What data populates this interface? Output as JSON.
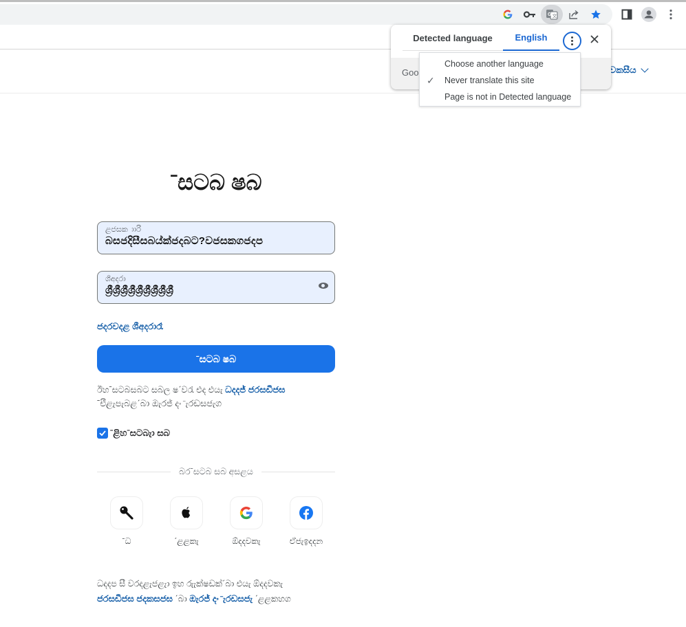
{
  "browser": {
    "omnibox_icons": [
      "google-lens-icon",
      "password-key-icon",
      "translate-icon",
      "share-icon",
      "bookmark-star-icon"
    ],
    "toolbar_icons": [
      "side-panel-icon",
      "profile-avatar-icon",
      "chrome-menu-icon"
    ],
    "accent_color": "#1a73e8"
  },
  "translate_popup": {
    "tabs": [
      {
        "label": "Detected language",
        "selected": false
      },
      {
        "label": "English",
        "selected": true
      }
    ],
    "footer_text": "Goo",
    "menu": {
      "items": [
        {
          "label": "Choose another language",
          "checked": false
        },
        {
          "label": "Never translate this site",
          "checked": true
        },
        {
          "label": "Page is not in Detected language",
          "checked": false
        }
      ]
    }
  },
  "header": {
    "language_selector": "වකසීය"
  },
  "login": {
    "title": "ˉසටබ ෂබ",
    "username": {
      "label": "ළජසක ාාරි",
      "value": "බසජදිසීසබය්ක්ජදබට?වජසකගජදප"
    },
    "password": {
      "label": "ශීඅදරා",
      "value": "ශ්‍රීශ්‍රීශ්‍රීශ්‍රීශ්‍රීශ්‍රීශ්‍රීශ්‍රීශ්‍රී",
      "toggle_icon": "eye-icon"
    },
    "forgot_password": "ජදරවදළ ශීඅදරාරෑ",
    "submit_label": "ˉසටබ ෂබ",
    "terms": {
      "prefix": "ඊහˉසටබසබට සබල ෂˊවරැ එද එයැ ",
      "link1": "ධදදජ් ජරසඩීජඝ",
      "line2_link": "ˉඑිළැපැබළˊබා ඔැරජ් දං ̄ැරඩසජැග"
    },
    "keep_signed_in": {
      "label": "ˉළිහˉසටබැා සබ",
      "checked": true
    },
    "divider_text": "බරˉසටබ සබ අසළය",
    "social": [
      {
        "icon": "passkey-icon",
        "label": "ˉධ"
      },
      {
        "icon": "apple-icon",
        "label": "ˊළළකැ"
      },
      {
        "icon": "google-icon",
        "label": "ඕදදවකැ"
      },
      {
        "icon": "facebook-icon",
        "label": "ඒජැඉදදන"
      }
    ],
    "footer_note": {
      "line1": "ධදදප සී වරදළැජළැා ඉහ රුැක්ෂඩක්ˊබා එයැ ඕදදවකැ",
      "link_a": "ජරසඩීජඝ ජදකසජඝ",
      "mid": "ˊබා ",
      "link_b": "ඔැරජ් දං ̄ැරඩසජැ",
      "suffix": "ˊළළකහග"
    }
  }
}
